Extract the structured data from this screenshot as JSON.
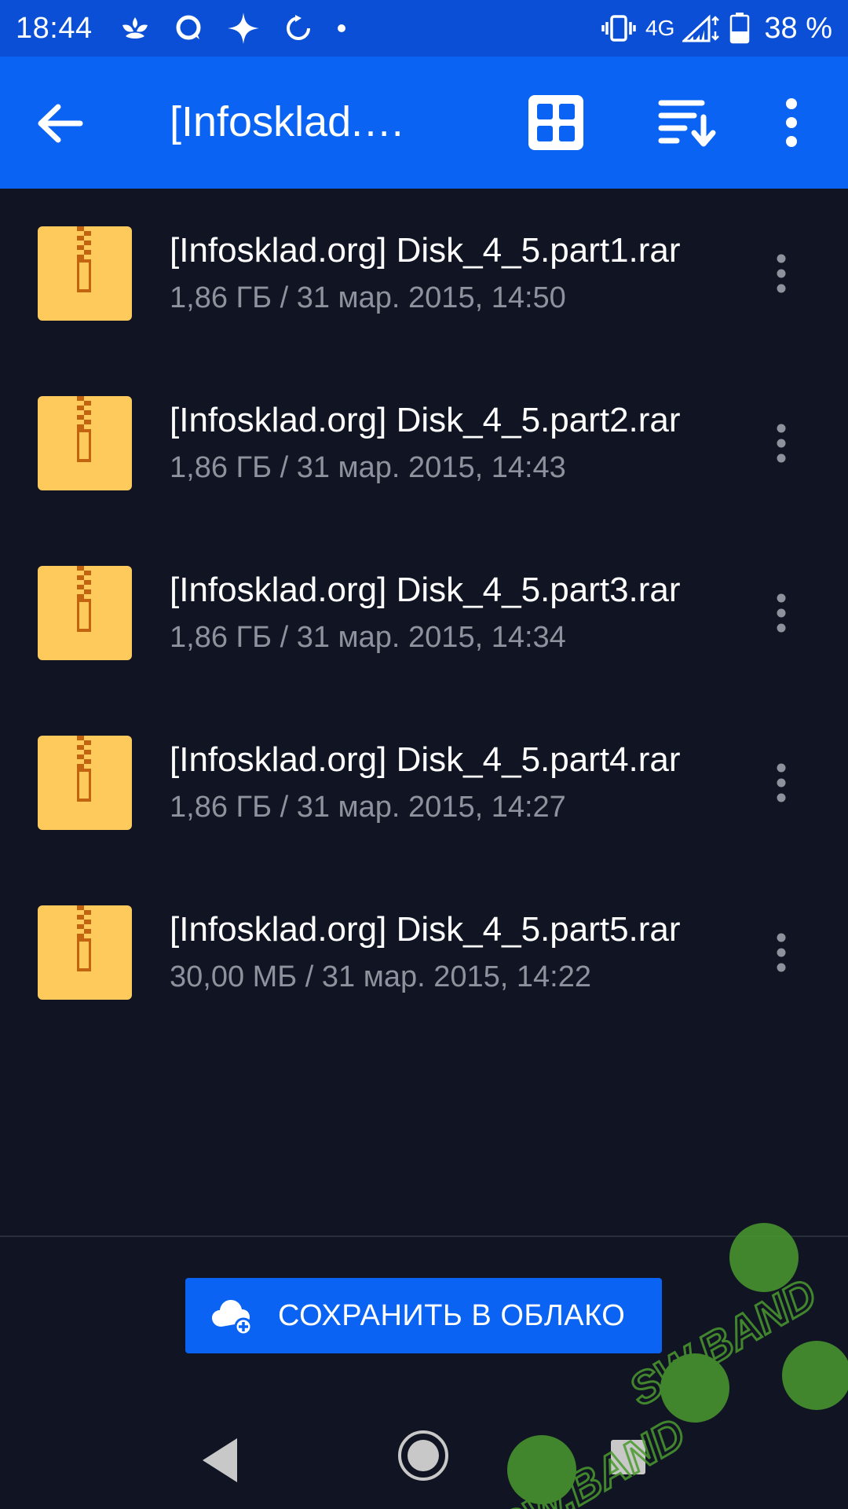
{
  "status_bar": {
    "time": "18:44",
    "network": "4G",
    "battery": "38 %"
  },
  "app_bar": {
    "title": "[Infosklad.…"
  },
  "files": [
    {
      "name": "[Infosklad.org] Disk_4_5.part1.rar",
      "meta": "1,86 ГБ / 31 мар. 2015, 14:50"
    },
    {
      "name": "[Infosklad.org] Disk_4_5.part2.rar",
      "meta": "1,86 ГБ / 31 мар. 2015, 14:43"
    },
    {
      "name": "[Infosklad.org] Disk_4_5.part3.rar",
      "meta": "1,86 ГБ / 31 мар. 2015, 14:34"
    },
    {
      "name": "[Infosklad.org] Disk_4_5.part4.rar",
      "meta": "1,86 ГБ / 31 мар. 2015, 14:27"
    },
    {
      "name": "[Infosklad.org] Disk_4_5.part5.rar",
      "meta": "30,00 МБ / 31 мар. 2015, 14:22"
    }
  ],
  "save_button": {
    "label": "СОХРАНИТЬ В ОБЛАКО"
  },
  "watermark": {
    "text": "SW.BAND"
  },
  "icons": {
    "back": "arrow-left-icon",
    "grid": "grid-view-icon",
    "sort": "sort-icon",
    "more": "more-vert-icon",
    "file": "archive-zip-icon",
    "cloud": "cloud-upload-icon"
  },
  "colors": {
    "status_bar": "#0a4fd6",
    "app_bar": "#0a63f2",
    "background": "#111523",
    "file_icon": "#ffca5c",
    "zipper": "#c1630f",
    "meta_text": "#8e929c",
    "watermark": "#4a9a2e"
  }
}
